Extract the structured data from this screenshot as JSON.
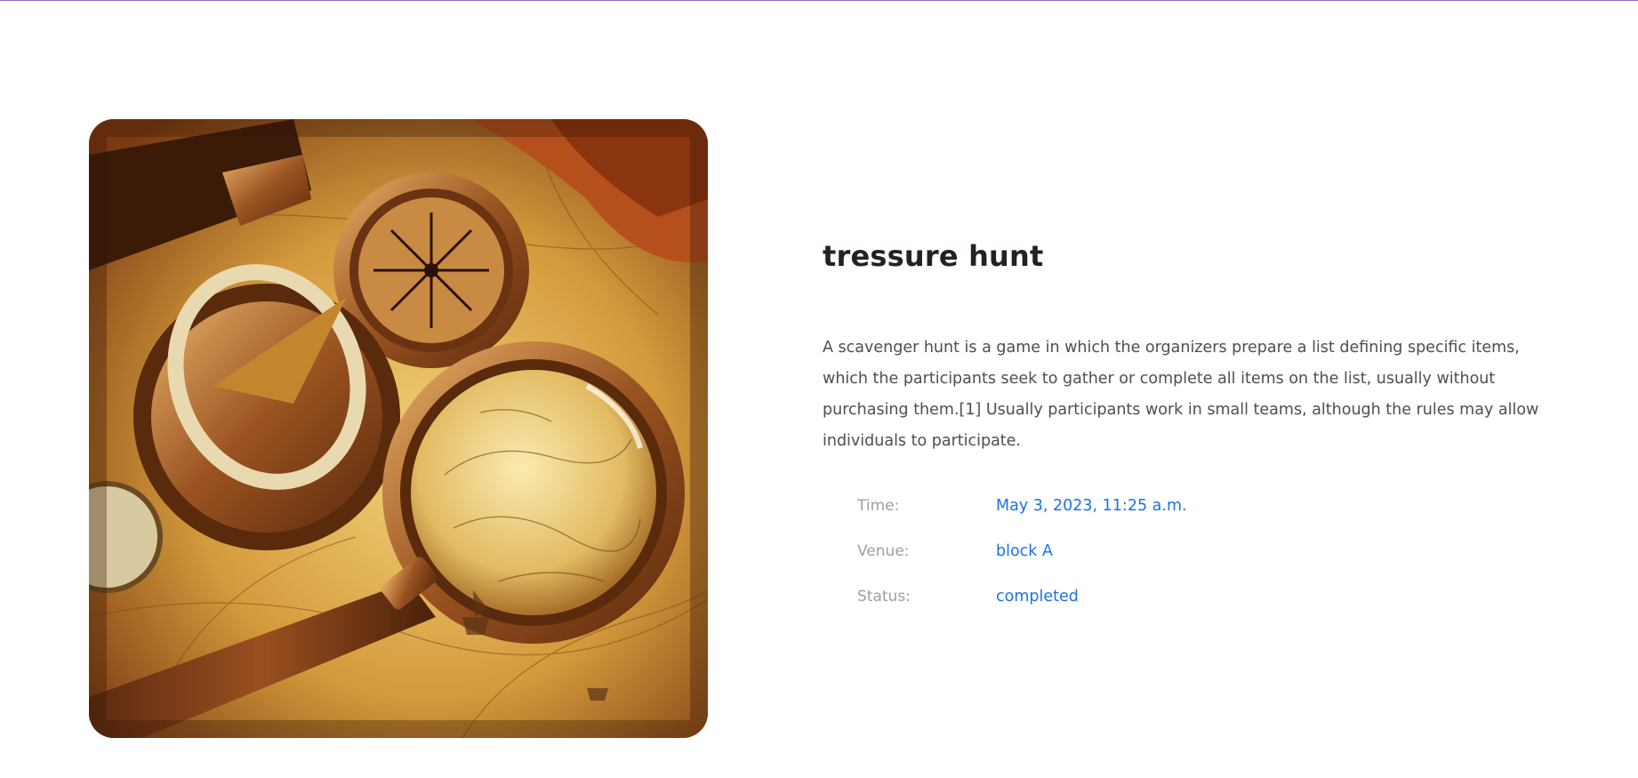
{
  "event": {
    "title": "tressure hunt",
    "description": "A scavenger hunt is a game in which the organizers prepare a list defining specific items, which the participants seek to gather or complete all items on the list, usually without purchasing them.[1] Usually participants work in small teams, although the rules may allow individuals to participate.",
    "details": [
      {
        "label": "Time:",
        "value": "May 3, 2023, 11:25 a.m."
      },
      {
        "label": "Venue:",
        "value": "block A"
      },
      {
        "label": "Status:",
        "value": "completed"
      }
    ]
  },
  "image": {
    "icon": "treasure-map-compass-magnifier-image"
  },
  "colors": {
    "accent": "#1a73e8",
    "title": "#1f2328",
    "label": "#9aa0a6",
    "body": "#4a4f55",
    "top_rule": "#8e6ab8"
  }
}
